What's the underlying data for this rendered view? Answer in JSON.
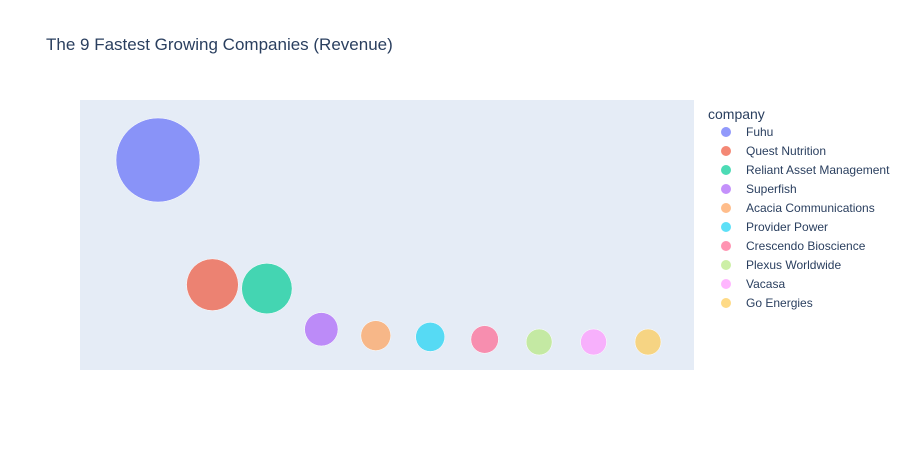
{
  "chart_data": {
    "type": "scatter",
    "title": "The 9 Fastest Growing Companies (Revenue)",
    "legend_title": "company",
    "legend_position": "right",
    "show_axes": false,
    "series": [
      {
        "name": "Fuhu",
        "x": 1,
        "y": 158000,
        "size": 158000,
        "color": "#636efa"
      },
      {
        "name": "Quest Nutrition",
        "x": 2,
        "y": 60000,
        "size": 60000,
        "color": "#EF553B"
      },
      {
        "name": "Reliant Asset Management",
        "x": 3,
        "y": 57000,
        "size": 57000,
        "color": "#00cc96"
      },
      {
        "name": "Superfish",
        "x": 4,
        "y": 25000,
        "size": 25000,
        "color": "#ab63fa"
      },
      {
        "name": "Acacia Communications",
        "x": 5,
        "y": 20000,
        "size": 20000,
        "color": "#FFA15A"
      },
      {
        "name": "Provider Power",
        "x": 6,
        "y": 19000,
        "size": 19000,
        "color": "#19d3f3"
      },
      {
        "name": "Crescendo Bioscience",
        "x": 7,
        "y": 17000,
        "size": 17000,
        "color": "#FF6692"
      },
      {
        "name": "Plexus Worldwide",
        "x": 8,
        "y": 15000,
        "size": 15000,
        "color": "#B6E880"
      },
      {
        "name": "Vacasa",
        "x": 9,
        "y": 15000,
        "size": 15000,
        "color": "#FF97FF"
      },
      {
        "name": "Go Energies",
        "x": 10,
        "y": 15000,
        "size": 15000,
        "color": "#FECB52"
      }
    ],
    "plot_background": "#e5ecf6",
    "marker_opacity": 0.7
  }
}
